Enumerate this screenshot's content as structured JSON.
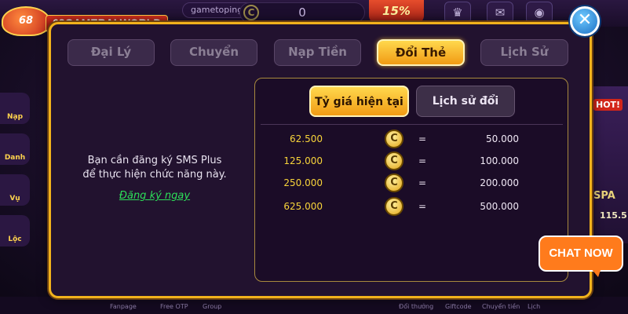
{
  "background": {
    "username": "gametoping",
    "balance": "0",
    "coin_symbol": "C",
    "promo": "15%",
    "left_items": [
      "Nạp",
      "Danh",
      "Vụ",
      "Lộc"
    ],
    "right_labels": [
      "HOT!",
      "SPA",
      "115.5"
    ],
    "bottom_labels": [
      "Fanpage",
      "Free OTP",
      "Group",
      "Đổi thưởng",
      "Giftcode",
      "Chuyển tiền",
      "Lịch"
    ]
  },
  "logo": {
    "badge": "68",
    "text": "68GAMEBAI.WORLD"
  },
  "modal": {
    "close_label": "✕",
    "tabs": [
      {
        "label": "Đại Lý",
        "active": false
      },
      {
        "label": "Chuyển",
        "active": false
      },
      {
        "label": "Nạp Tiền",
        "active": false
      },
      {
        "label": "Đổi Thẻ",
        "active": true
      },
      {
        "label": "Lịch Sử",
        "active": false
      }
    ],
    "message_line1": "Bạn cần đăng ký SMS Plus",
    "message_line2": "để thực hiện chức năng này.",
    "register_link": "Đăng ký ngay",
    "subtabs": {
      "rate": "Tỷ giá hiện tại",
      "history": "Lịch sử đổi"
    },
    "rates": [
      {
        "coins": "62.500",
        "eq": "=",
        "value": "50.000"
      },
      {
        "coins": "125.000",
        "eq": "=",
        "value": "100.000"
      },
      {
        "coins": "250.000",
        "eq": "=",
        "value": "200.000"
      },
      {
        "coins": "625.000",
        "eq": "=",
        "value": "500.000"
      }
    ]
  },
  "chat": {
    "label": "CHAT NOW"
  },
  "colors": {
    "accent_gold": "#f2b21c",
    "link_green": "#2ddf59",
    "chat_orange": "#ff7b1c"
  }
}
